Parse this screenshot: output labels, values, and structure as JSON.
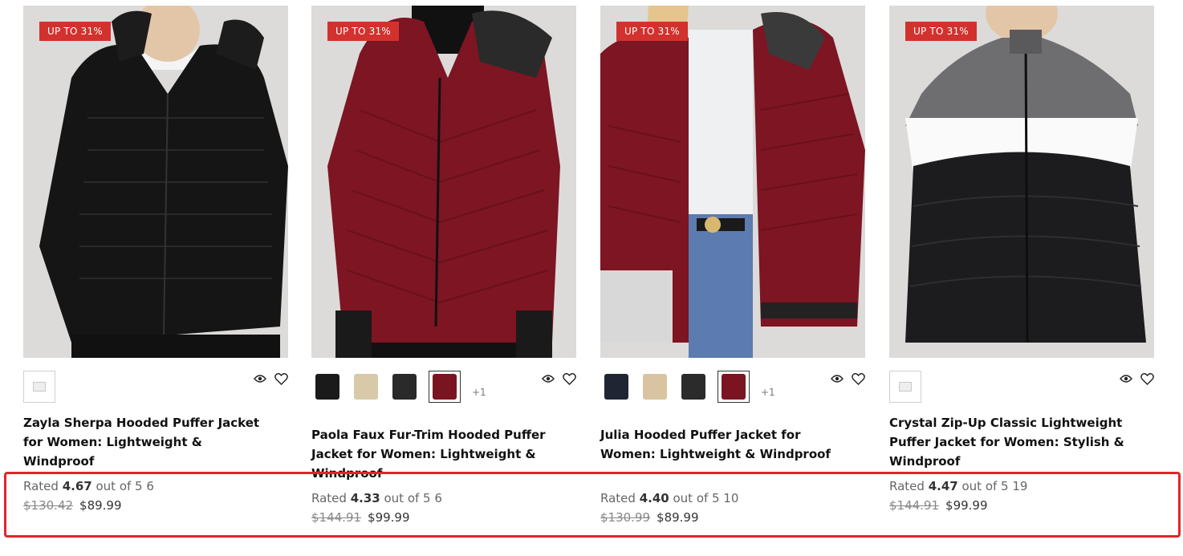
{
  "products": [
    {
      "badge": "UP TO 31%",
      "image_alt": "Black sherpa hooded puffer jacket",
      "swatches": [],
      "more_swatches": "",
      "title": "Zayla Sherpa Hooded Puffer Jacket for Women: Lightweight & Windproof",
      "rating_prefix": "Rated",
      "rating_value": "4.67",
      "rating_suffix": "out of 5",
      "review_count": "6",
      "old_price": "$130.42",
      "price": "$89.99"
    },
    {
      "badge": "UP TO 31%",
      "image_alt": "Burgundy faux fur-trim hooded puffer jacket",
      "swatches": [
        "#1a1a1a",
        "#d8c9a8",
        "#2a2a2a",
        "#7a1420"
      ],
      "more_swatches": "+1",
      "title": "Paola Faux Fur-Trim Hooded Puffer Jacket for Women: Lightweight & Windproof",
      "rating_prefix": "Rated",
      "rating_value": "4.33",
      "rating_suffix": "out of 5",
      "review_count": "6",
      "old_price": "$144.91",
      "price": "$99.99"
    },
    {
      "badge": "UP TO 31%",
      "image_alt": "Burgundy hooded puffer jacket",
      "swatches": [
        "#1f2533",
        "#d8c4a0",
        "#2b2b2b",
        "#7a1420"
      ],
      "more_swatches": "+1",
      "title": "Julia Hooded Puffer Jacket for Women: Lightweight & Windproof",
      "rating_prefix": "Rated",
      "rating_value": "4.40",
      "rating_suffix": "out of 5",
      "review_count": "10",
      "old_price": "$130.99",
      "price": "$89.99"
    },
    {
      "badge": "UP TO 31%",
      "image_alt": "Color-block zip-up puffer jacket",
      "swatches": [],
      "more_swatches": "",
      "title": "Crystal Zip-Up Classic Lightweight Puffer Jacket for Women: Stylish & Windproof",
      "rating_prefix": "Rated",
      "rating_value": "4.47",
      "rating_suffix": "out of 5",
      "review_count": "19",
      "old_price": "$144.91",
      "price": "$99.99"
    }
  ],
  "colors": {
    "badge": "#d2322d",
    "highlight": "#e3242b",
    "image_bg": "#dcdbd9"
  }
}
